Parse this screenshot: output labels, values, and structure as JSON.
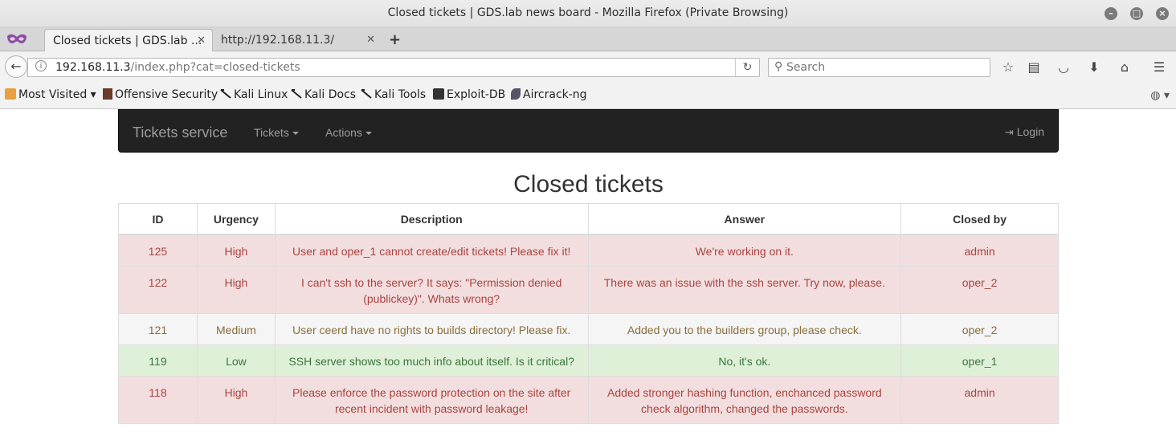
{
  "window": {
    "title": "Closed tickets | GDS.lab news board - Mozilla Firefox (Private Browsing)"
  },
  "tabs": [
    {
      "label": "Closed tickets | GDS.lab ..."
    },
    {
      "label": "http://192.168.11.3/"
    }
  ],
  "navbar": {
    "url_host": "192.168.11.3",
    "url_path": "/index.php?cat=closed-tickets",
    "search_placeholder": "Search"
  },
  "bookmarks": [
    {
      "label": "Most Visited",
      "icon": "most-visited-icon"
    },
    {
      "label": "Offensive Security",
      "icon": "offsec-icon"
    },
    {
      "label": "Kali Linux",
      "icon": "kali-dragon-icon"
    },
    {
      "label": "Kali Docs",
      "icon": "kali-dragon-icon"
    },
    {
      "label": "Kali Tools",
      "icon": "kali-dragon-icon"
    },
    {
      "label": "Exploit-DB",
      "icon": "exploitdb-icon"
    },
    {
      "label": "Aircrack-ng",
      "icon": "aircrack-icon"
    }
  ],
  "app": {
    "brand": "Tickets service",
    "menu_tickets": "Tickets",
    "menu_actions": "Actions",
    "login": "Login"
  },
  "page": {
    "title": "Closed tickets"
  },
  "table": {
    "headers": [
      "ID",
      "Urgency",
      "Description",
      "Answer",
      "Closed by"
    ],
    "rows": [
      {
        "status": "danger",
        "id": "125",
        "urgency": "High",
        "description": "User and oper_1 cannot create/edit tickets! Please fix it!",
        "answer": "We're working on it.",
        "closed_by": "admin"
      },
      {
        "status": "danger",
        "id": "122",
        "urgency": "High",
        "description": "I can't ssh to the server? It says: \"Permission denied (publickey)\". Whats wrong?",
        "answer": "There was an issue with the ssh server. Try now, please.",
        "closed_by": "oper_2"
      },
      {
        "status": "warning",
        "id": "121",
        "urgency": "Medium",
        "description": "User ceerd have no rights to builds directory! Please fix.",
        "answer": "Added you to the builders group, please check.",
        "closed_by": "oper_2"
      },
      {
        "status": "success",
        "id": "119",
        "urgency": "Low",
        "description": "SSH server shows too much info about itself. Is it critical?",
        "answer": "No, it's ok.",
        "closed_by": "oper_1"
      },
      {
        "status": "danger",
        "id": "118",
        "urgency": "High",
        "description": "Please enforce the password protection on the site after recent incident with password leakage!",
        "answer": "Added stronger hashing function, enchanced password check algorithm, changed the passwords.",
        "closed_by": "admin"
      }
    ]
  }
}
